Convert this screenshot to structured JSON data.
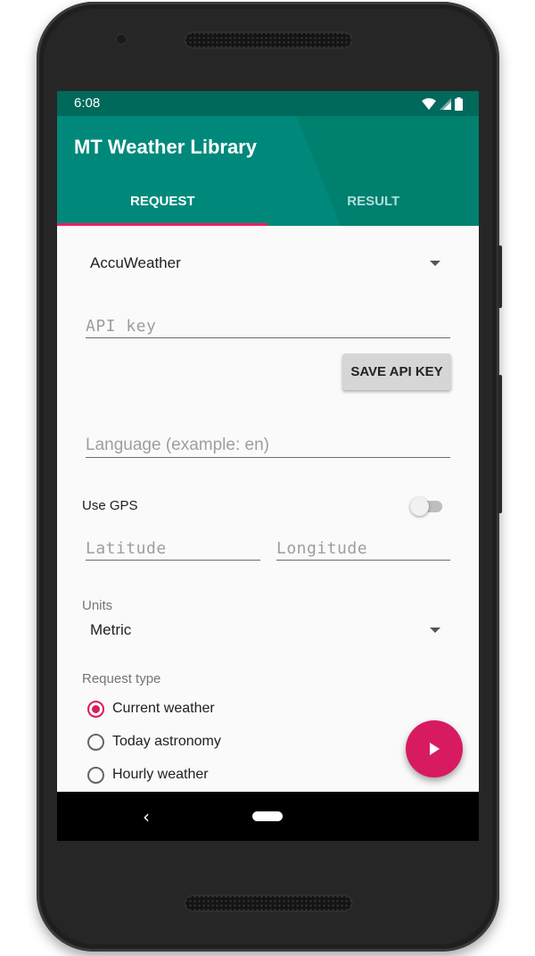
{
  "status_bar": {
    "time": "6:08",
    "icons": [
      "wifi-icon",
      "signal-icon",
      "battery-icon"
    ]
  },
  "app_bar": {
    "title": "MT Weather Library"
  },
  "tabs": [
    {
      "label": "REQUEST",
      "active": true
    },
    {
      "label": "RESULT",
      "active": false
    }
  ],
  "form": {
    "provider_spinner": {
      "selected": "AccuWeather"
    },
    "api_key": {
      "value": "",
      "placeholder": "API key"
    },
    "save_api_key_button": "SAVE API KEY",
    "language": {
      "value": "",
      "placeholder": "Language (example: en)"
    },
    "use_gps": {
      "label": "Use GPS",
      "checked": false
    },
    "latitude": {
      "value": "",
      "placeholder": "Latitude"
    },
    "longitude": {
      "value": "",
      "placeholder": "Longitude"
    },
    "units": {
      "label": "Units",
      "selected": "Metric"
    },
    "request_type": {
      "label": "Request type",
      "options": [
        {
          "label": "Current weather",
          "checked": true
        },
        {
          "label": "Today astronomy",
          "checked": false
        },
        {
          "label": "Hourly weather",
          "checked": false
        }
      ]
    }
  },
  "fab": {
    "icon": "play-icon"
  },
  "nav_bar": {
    "back_icon": "‹",
    "home_icon": "home-pill-icon"
  },
  "colors": {
    "primary": "#00897b",
    "primary_dark": "#00695c",
    "accent": "#d81b60",
    "tab_inactive": "#b2dfdb"
  }
}
